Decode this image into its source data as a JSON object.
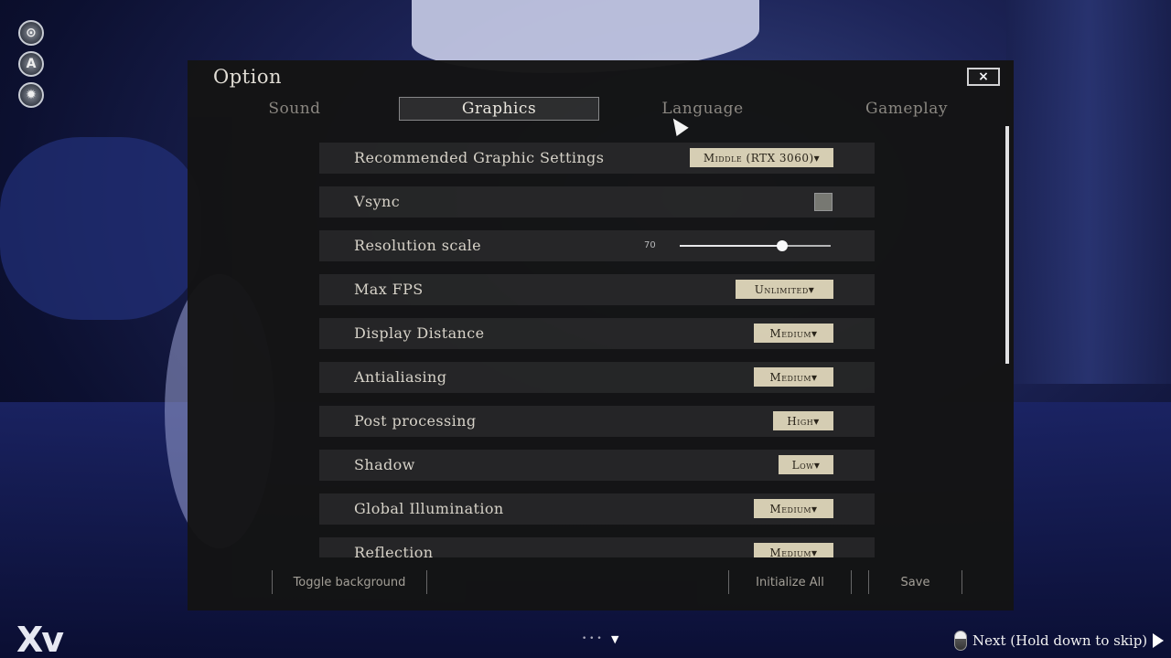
{
  "side_icons": [
    {
      "icon": "gamepad-icon",
      "glyph": "⊙"
    },
    {
      "icon": "auto-icon",
      "glyph": "A"
    },
    {
      "icon": "settings-gear-icon",
      "glyph": "✹"
    }
  ],
  "option_panel": {
    "title": "Option",
    "close_icon": "×",
    "tabs": [
      {
        "label": "Sound",
        "active": false
      },
      {
        "label": "Graphics",
        "active": true
      },
      {
        "label": "Language",
        "active": false
      },
      {
        "label": "Gameplay",
        "active": false
      }
    ],
    "settings": [
      {
        "label": "Recommended Graphic Settings",
        "control": "dropdown",
        "value": "Middle (RTX 3060)▾"
      },
      {
        "label": "Vsync",
        "control": "checkbox",
        "checked": false
      },
      {
        "label": "Resolution scale",
        "control": "slider",
        "value": "70",
        "fraction": 0.68
      },
      {
        "label": "Max FPS",
        "control": "dropdown",
        "value": "Unlimited▾"
      },
      {
        "label": "Display Distance",
        "control": "dropdown",
        "value": "Medium▾"
      },
      {
        "label": "Antialiasing",
        "control": "dropdown",
        "value": "Medium▾"
      },
      {
        "label": "Post processing",
        "control": "dropdown",
        "value": "High▾"
      },
      {
        "label": "Shadow",
        "control": "dropdown",
        "value": "Low▾"
      },
      {
        "label": "Global Illumination",
        "control": "dropdown",
        "value": "Medium▾"
      },
      {
        "label": "Reflection",
        "control": "dropdown",
        "value": "Medium▾"
      }
    ],
    "footer": {
      "toggle_background": "Toggle background",
      "initialize_all": "Initialize All",
      "save": "Save"
    }
  },
  "bottom_bar": {
    "logo": "Xv",
    "page_dots": "• • •",
    "page_arrow": "▼",
    "next_hint": "Next (Hold down to skip)"
  }
}
